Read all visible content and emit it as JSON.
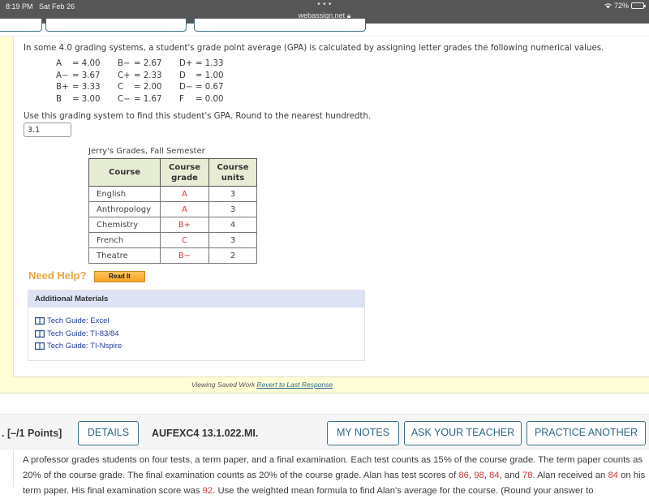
{
  "status_bar": {
    "time": "8:19 PM",
    "date": "Sat Feb 26",
    "url": "webassign.net",
    "battery": "72%",
    "battery_level": 0.72
  },
  "question1": {
    "intro": "In some 4.0 grading systems, a student's grade point average (GPA) is calculated by assigning letter grades the following numerical values.",
    "grade_scale": [
      [
        {
          "letter": "A",
          "value": "= 4.00"
        },
        {
          "letter": "B−",
          "value": "= 2.67"
        },
        {
          "letter": "D+",
          "value": "= 1.33"
        }
      ],
      [
        {
          "letter": "A−",
          "value": "= 3.67"
        },
        {
          "letter": "C+",
          "value": "= 2.33"
        },
        {
          "letter": "D",
          "value": "= 1.00"
        }
      ],
      [
        {
          "letter": "B+",
          "value": "= 3.33"
        },
        {
          "letter": "C",
          "value": "= 2.00"
        },
        {
          "letter": "D−",
          "value": "= 0.67"
        }
      ],
      [
        {
          "letter": "B",
          "value": "= 3.00"
        },
        {
          "letter": "C−",
          "value": "= 1.67"
        },
        {
          "letter": "F",
          "value": "= 0.00"
        }
      ]
    ],
    "instruction": "Use this grading system to find this student's GPA. Round to the nearest hundredth.",
    "answer_value": "3.1",
    "table": {
      "caption": "Jerry's Grades, Fall Semester",
      "headers": [
        "Course",
        "Course grade",
        "Course units"
      ],
      "headers_lines": [
        [
          "Course"
        ],
        [
          "Course",
          "grade"
        ],
        [
          "Course",
          "units"
        ]
      ],
      "rows": [
        {
          "course": "English",
          "grade": "A",
          "units": "3"
        },
        {
          "course": "Anthropology",
          "grade": "A",
          "units": "3"
        },
        {
          "course": "Chemistry",
          "grade": "B+",
          "units": "4"
        },
        {
          "course": "French",
          "grade": "C",
          "units": "3"
        },
        {
          "course": "Theatre",
          "grade": "B−",
          "units": "2"
        }
      ]
    },
    "need_help": "Need Help?",
    "read_it": "Read It",
    "additional_materials": {
      "title": "Additional Materials",
      "items": [
        "Tech Guide: Excel",
        "Tech Guide: TI-83/84",
        "Tech Guide: TI-Nspire"
      ]
    },
    "saved_work_text": "Viewing Saved Work",
    "revert_link": "Revert to Last Response"
  },
  "question2": {
    "points": ". [–/1 Points]",
    "details_button": "DETAILS",
    "code": "AUFEXC4 13.1.022.MI.",
    "my_notes_button": "MY NOTES",
    "ask_teacher_button": "ASK YOUR TEACHER",
    "practice_button": "PRACTICE ANOTHER",
    "text_parts": {
      "p1": "A professor grades students on four tests, a term paper, and a final examination. Each test counts as 15% of the course grade. The term paper counts as 20% of the course grade. The final examination counts as 20% of the course grade. Alan has test scores of ",
      "s1": "86",
      "c1": ", ",
      "s2": "98",
      "c2": ", ",
      "s3": "84",
      "c3": ", and ",
      "s4": "78",
      "p2": ". Alan received an ",
      "s5": "84",
      "p3": " on his term paper. His final examination score was ",
      "s6": "92",
      "p4": ". Use the weighted mean formula to find Alan's average for the course. (Round your answer to"
    }
  },
  "colors": {
    "accent_button_border": "#3b6f86",
    "grade_red": "#d43a3a",
    "need_help_orange": "#e8a540",
    "frame_yellow": "#fffdd6",
    "materials_header": "#dde3f5"
  }
}
